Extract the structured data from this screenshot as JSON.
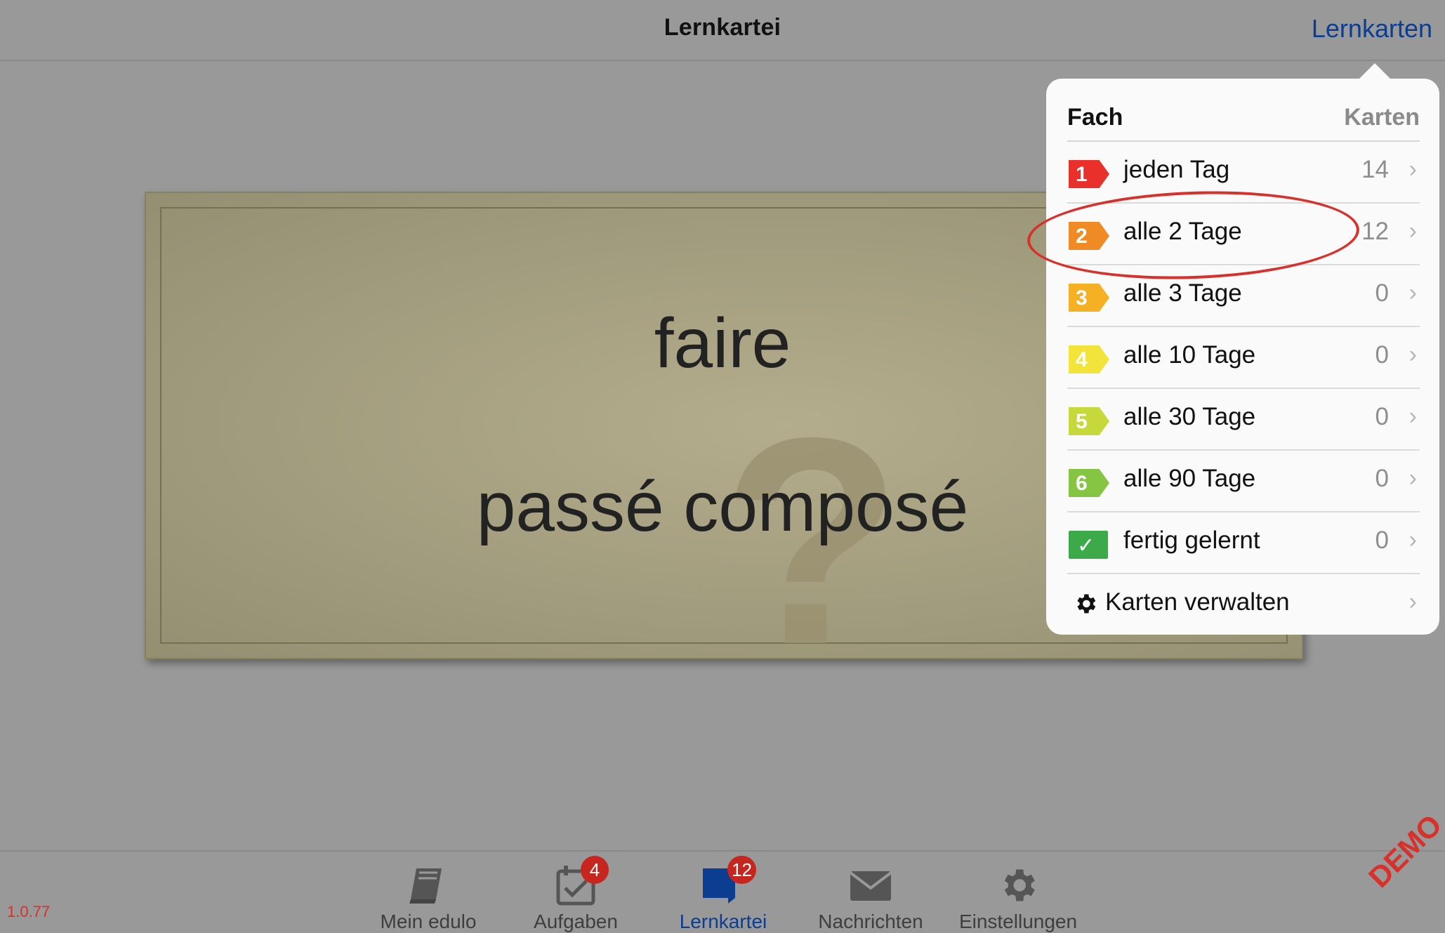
{
  "header": {
    "title": "Lernkartei",
    "nav_button": "Lernkarten"
  },
  "card": {
    "question_mark": "?",
    "front": "faire",
    "back": "passé composé"
  },
  "popover": {
    "col_fach": "Fach",
    "col_karten": "Karten",
    "rows": [
      {
        "num": "1",
        "label": "jeden Tag",
        "count": "14",
        "color": "#e9302a"
      },
      {
        "num": "2",
        "label": "alle 2 Tage",
        "count": "12",
        "color": "#f08a24"
      },
      {
        "num": "3",
        "label": "alle 3 Tage",
        "count": "0",
        "color": "#f5b123"
      },
      {
        "num": "4",
        "label": "alle 10 Tage",
        "count": "0",
        "color": "#f2e43a"
      },
      {
        "num": "5",
        "label": "alle 30 Tage",
        "count": "0",
        "color": "#c6d83a"
      },
      {
        "num": "6",
        "label": "alle 90 Tage",
        "count": "0",
        "color": "#86c443"
      },
      {
        "num": "✓",
        "label": "fertig gelernt",
        "count": "0",
        "color": "#3daa49"
      }
    ],
    "manage_label": "Karten verwalten",
    "chevron": "›"
  },
  "tabs": [
    {
      "label": "Mein edulo",
      "icon": "book-icon",
      "badge": ""
    },
    {
      "label": "Aufgaben",
      "icon": "calendar-check-icon",
      "badge": "4"
    },
    {
      "label": "Lernkartei",
      "icon": "flashcard-icon",
      "badge": "12"
    },
    {
      "label": "Nachrichten",
      "icon": "envelope-icon",
      "badge": ""
    },
    {
      "label": "Einstellungen",
      "icon": "gear-icon",
      "badge": ""
    }
  ],
  "footer": {
    "version": "1.0.77",
    "demo": "DEMO"
  },
  "colors": {
    "accent": "#0b3d91",
    "badge": "#c7261f",
    "highlight": "#d8302a"
  }
}
